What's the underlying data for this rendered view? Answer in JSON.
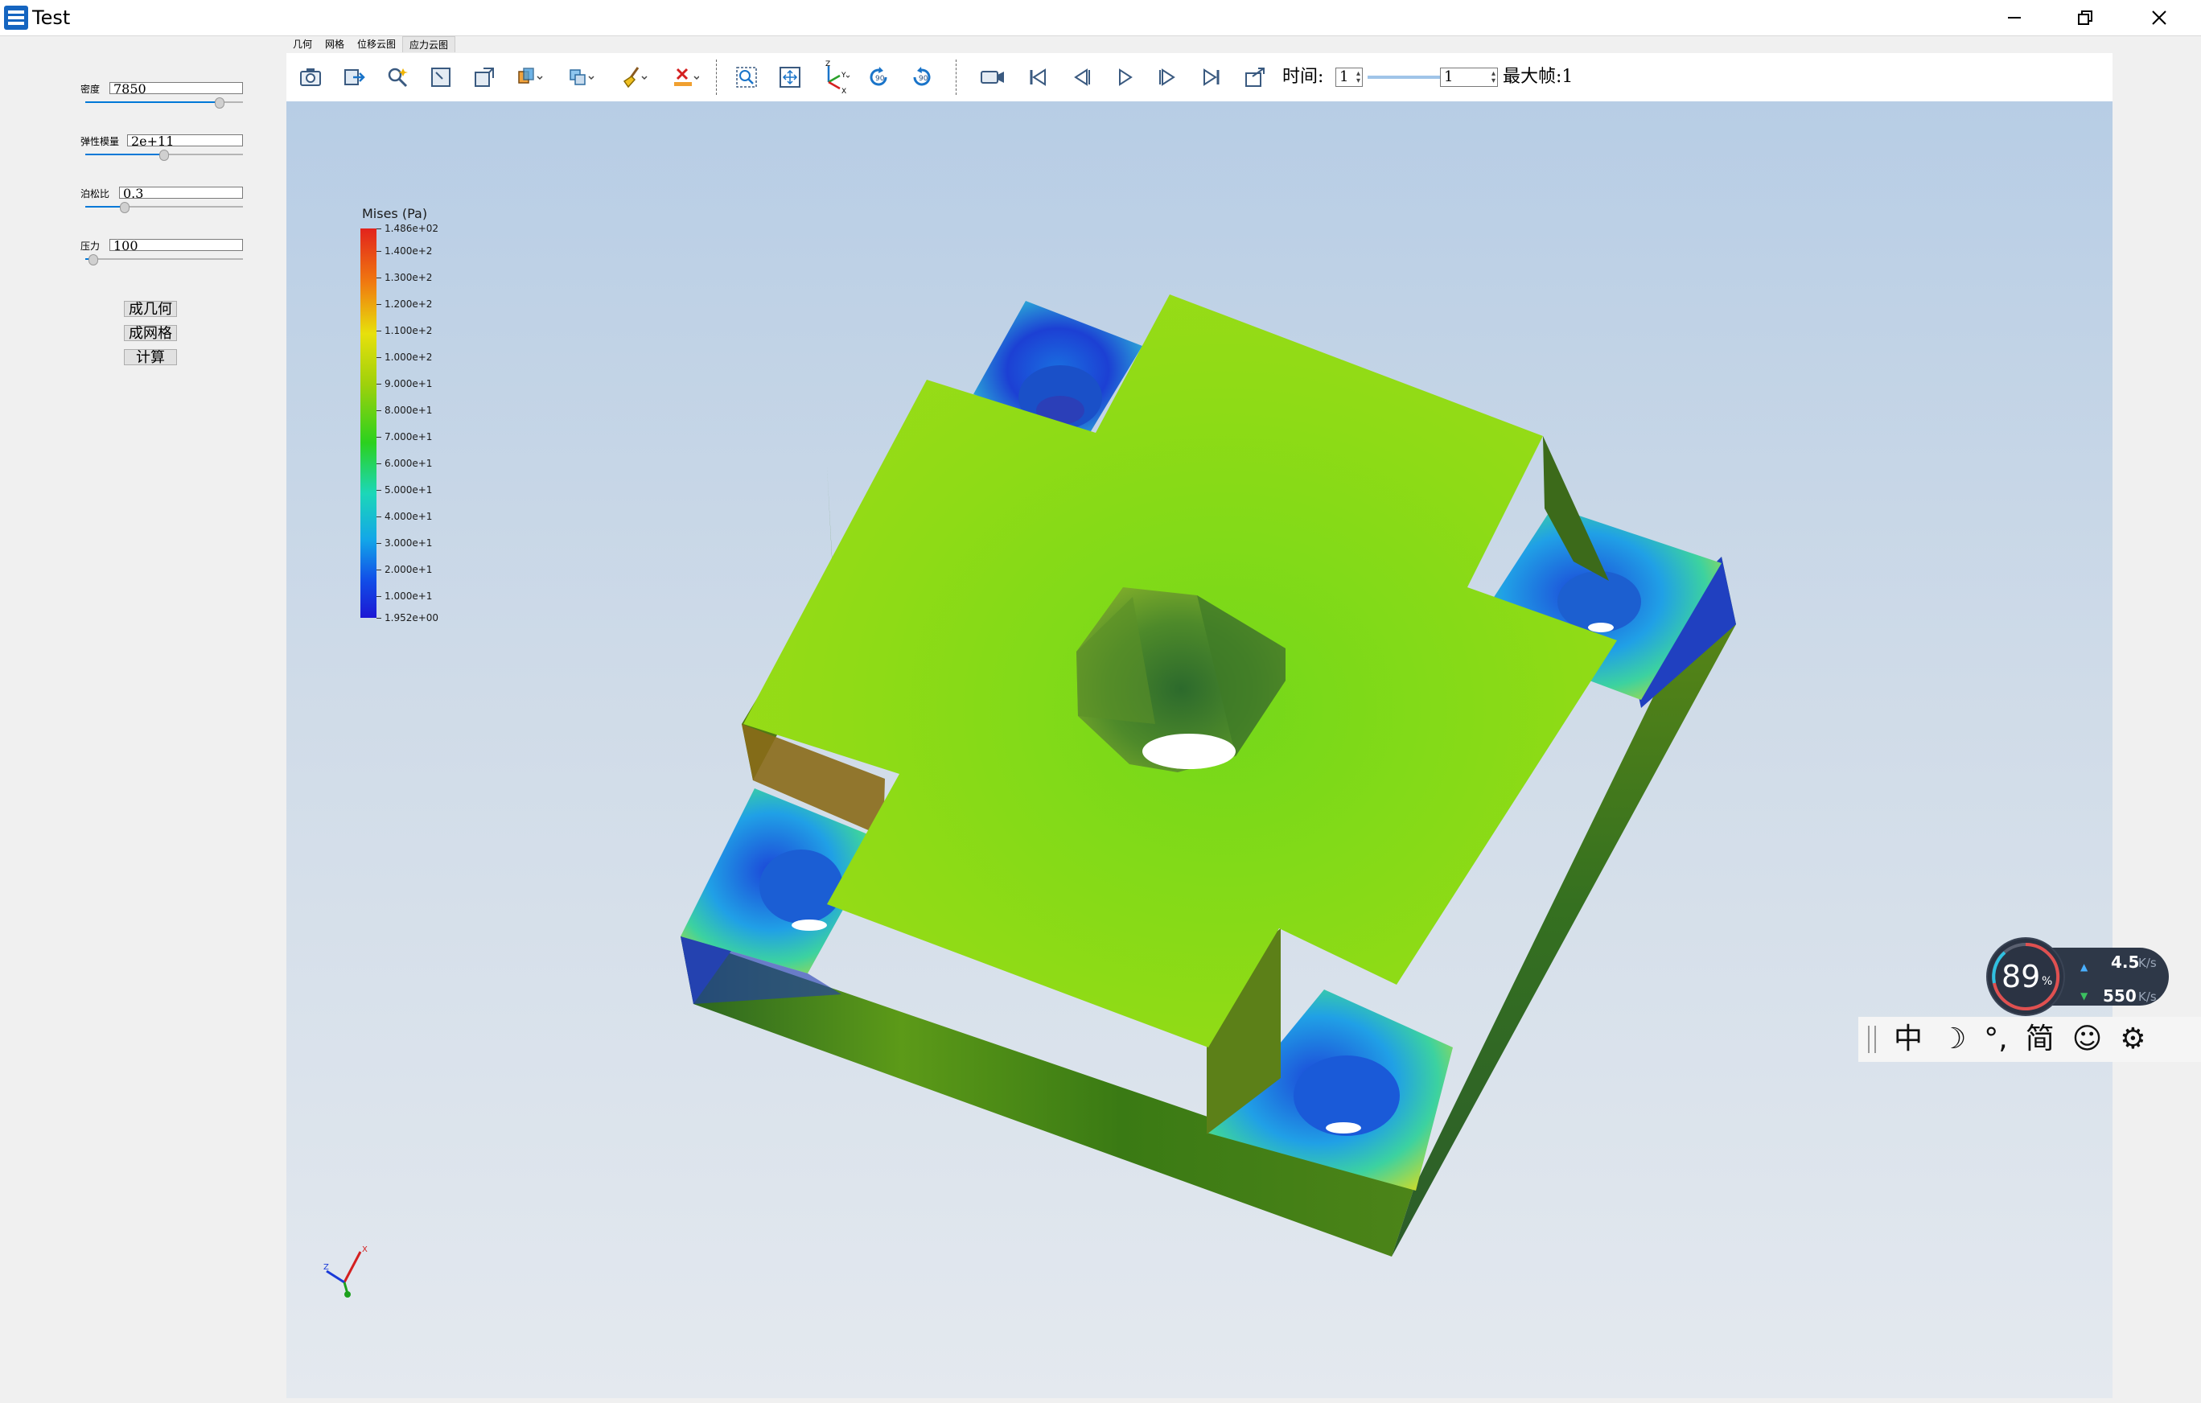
{
  "window": {
    "title": "Test"
  },
  "left_panel": {
    "params": [
      {
        "label": "密度",
        "value": "7850",
        "slider_fraction": 0.85
      },
      {
        "label": "弹性模量",
        "value": "2e+11",
        "slider_fraction": 0.5
      },
      {
        "label": "泊松比",
        "value": "0.3",
        "slider_fraction": 0.25
      },
      {
        "label": "压力",
        "value": "100",
        "slider_fraction": 0.05
      }
    ],
    "buttons": [
      "成几何",
      "成网格",
      "计算"
    ]
  },
  "tabs": [
    "几何",
    "网格",
    "位移云图",
    "应力云图"
  ],
  "active_tab": "应力云图",
  "toolbar": {
    "icons": [
      "camera-icon",
      "export-icon",
      "probe-icon",
      "view-front-icon",
      "view-iso-icon",
      "cut-icon",
      "clip-icon",
      "clean-icon",
      "delete-icon",
      "zoom-box-icon",
      "fit-view-icon",
      "axes-icon",
      "rotate-cw-icon",
      "rotate-ccw-icon",
      "record-icon",
      "first-frame-icon",
      "prev-frame-icon",
      "play-icon",
      "next-frame-icon",
      "last-frame-icon",
      "loop-icon"
    ],
    "time_label": "时间:",
    "time_value": "1",
    "frame_value": "1",
    "frame_slider_fraction": 0.95,
    "max_frame_label": "最大帧:1"
  },
  "legend": {
    "title": "Mises (Pa)",
    "ticks": [
      "1.486e+02",
      "1.400e+2",
      "1.300e+2",
      "1.200e+2",
      "1.100e+2",
      "1.000e+2",
      "9.000e+1",
      "8.000e+1",
      "7.000e+1",
      "6.000e+1",
      "5.000e+1",
      "4.000e+1",
      "3.000e+1",
      "2.000e+1",
      "1.000e+1",
      "1.952e+00"
    ],
    "tick_values": [
      148.6,
      140,
      130,
      120,
      110,
      100,
      90,
      80,
      70,
      60,
      50,
      40,
      30,
      20,
      10,
      1.952
    ],
    "max": 148.6,
    "min": 1.952
  },
  "axes": {
    "x": "X",
    "y": "Y",
    "z": "Z"
  },
  "net_widget": {
    "cpu_percent": "89",
    "percent_sign": "%",
    "upload": "4.5",
    "download": "550",
    "unit": "K/s"
  },
  "ime": {
    "items": [
      "中",
      "☽",
      "°,",
      "简",
      "☺",
      "⚙"
    ]
  }
}
